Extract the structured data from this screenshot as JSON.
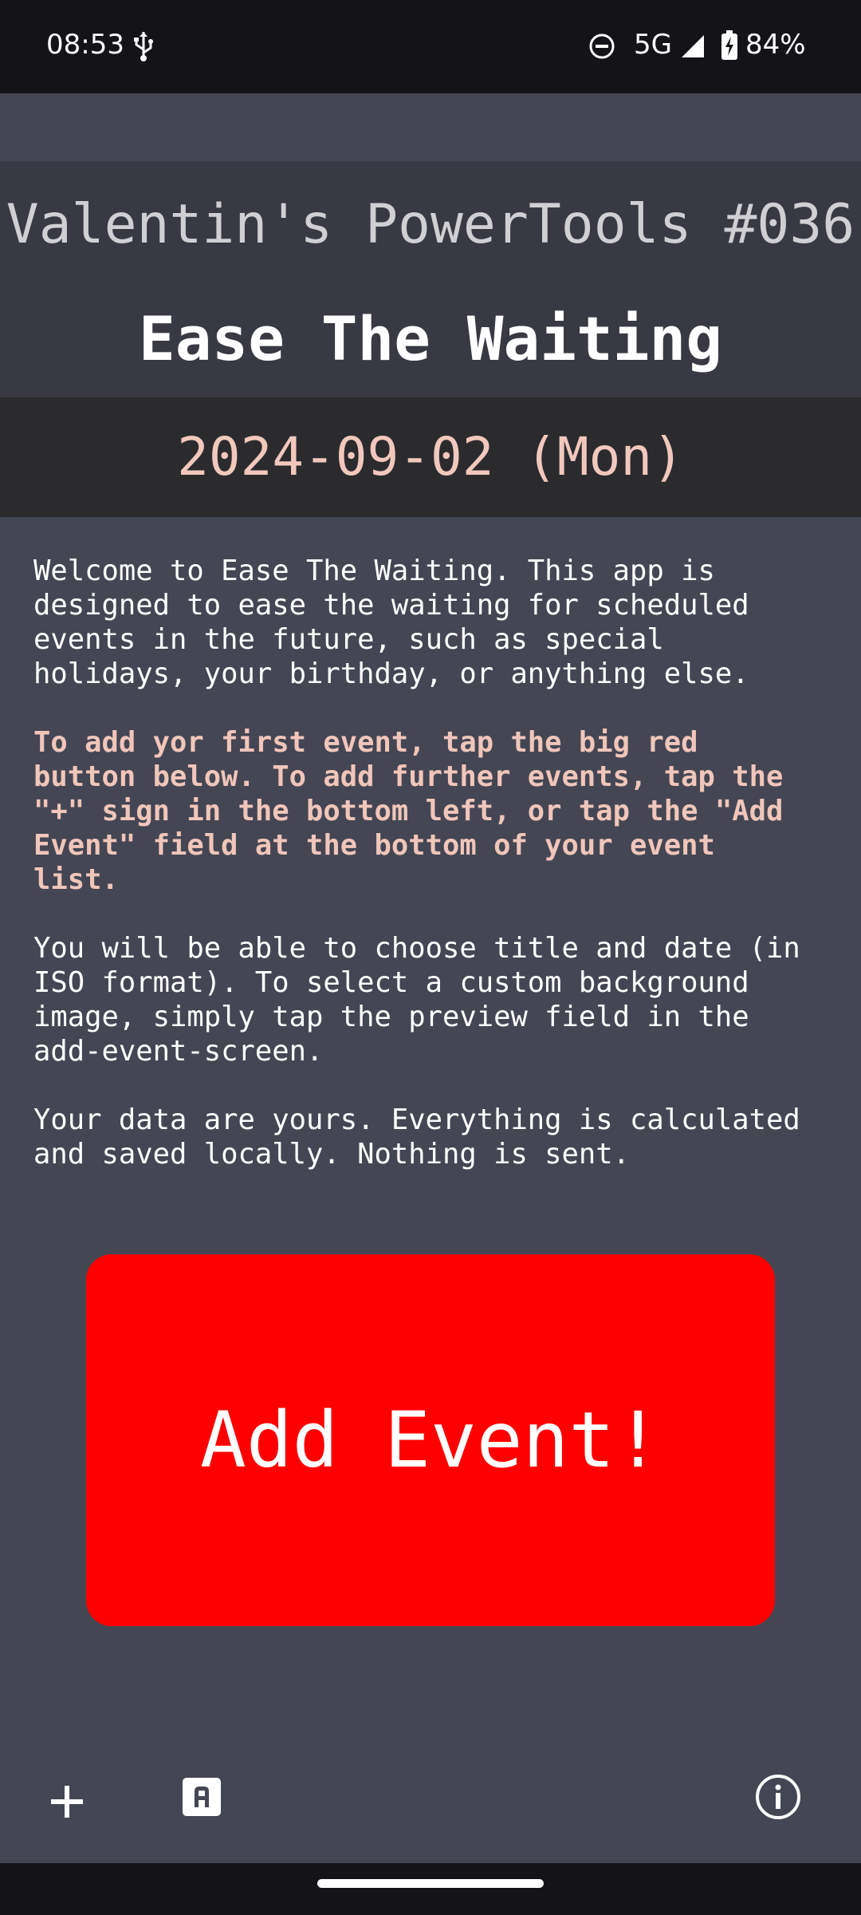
{
  "status_bar": {
    "time": "08:53",
    "network": "5G",
    "battery": "84%",
    "icons": [
      "usb-icon",
      "do-not-disturb-icon",
      "cell-signal-icon",
      "battery-charging-icon"
    ]
  },
  "header": {
    "suite_title": "Valentin's PowerTools #036",
    "app_title": "Ease The Waiting"
  },
  "date_band": {
    "date": "2024-09-02 (Mon)"
  },
  "content": {
    "intro": "Welcome to Ease The Waiting. This app is\ndesigned to ease the waiting for scheduled\nevents in the future, such as special\nholidays, your birthday, or anything else.",
    "instructions": "To add yor first event, tap the big red\nbutton below. To add further events, tap the\n\"+\" sign in the bottom left, or tap the \"Add\nEvent\" field at the bottom of your event\nlist.",
    "format_info": "You will be able to choose title and date (in\nISO format). To select a custom background\nimage, simply tap the preview field in the\nadd-event-screen.",
    "privacy": "Your data are yours. Everything is calculated\nand saved locally. Nothing is sent."
  },
  "add_button": {
    "label": "Add Event!"
  },
  "bottom_bar": {
    "icons": [
      "plus-icon",
      "font-icon",
      "info-icon"
    ]
  },
  "colors": {
    "background": "#454653",
    "header_background": "#393943",
    "date_background": "#2b2b2e",
    "accent_text": "#f0c6bb",
    "button_red": "#ff0000"
  }
}
